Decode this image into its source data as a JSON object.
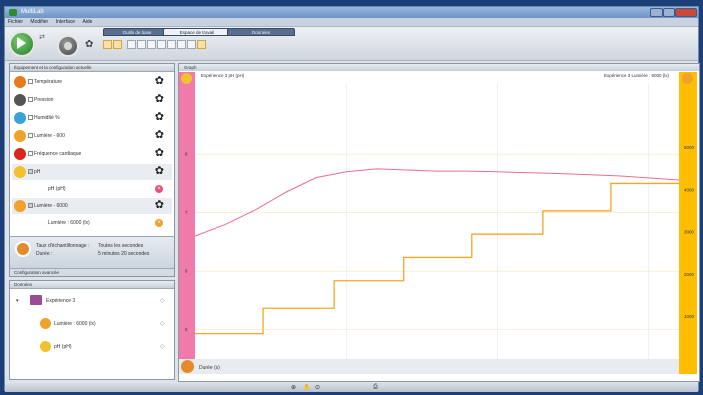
{
  "app": {
    "title": "MultiLab"
  },
  "menu": [
    "Fichier",
    "Modifier",
    "Interface",
    "Aide"
  ],
  "tabs": [
    {
      "label": "Outils de base",
      "active": false
    },
    {
      "label": "Espace de travail",
      "active": true
    },
    {
      "label": "Données",
      "active": false
    }
  ],
  "config_panel": {
    "title": "Équipement et la configuration actuelle",
    "sensors": [
      {
        "label": "Température",
        "icon": "thermometer-icon",
        "color": "#e87a1e"
      },
      {
        "label": "Pression",
        "icon": "pressure-icon",
        "color": "#555555"
      },
      {
        "label": "Humidité %",
        "icon": "humidity-icon",
        "color": "#39a3d8"
      },
      {
        "label": "Lumière - 600",
        "icon": "light-icon",
        "color": "#f0a22a"
      },
      {
        "label": "Fréquence cardiaque",
        "icon": "heart-icon",
        "color": "#d8261d"
      },
      {
        "label": "pH",
        "icon": "ph-icon",
        "color": "#f2c12e",
        "checked": true
      },
      {
        "label": "Lumière - 6000",
        "icon": "light-icon",
        "color": "#f0a22a",
        "checked": true
      }
    ],
    "sub_items": [
      {
        "label": "pH (pH)",
        "dot_color": "#e8537a"
      },
      {
        "label": "Lumière : 6000 (lx)",
        "dot_color": "#f0a22a"
      }
    ],
    "rate_label": "Taux d'échantillonnage :",
    "rate_value": "Toutes les secondes",
    "duration_label": "Durée :",
    "duration_value": "5 minutes 20 secondes",
    "footer": "Configuration avancée"
  },
  "data_panel": {
    "title": "Données",
    "experiment": "Expérience 3",
    "items": [
      {
        "label": "Lumière : 6000 (lx)"
      },
      {
        "label": "pH (pH)"
      }
    ]
  },
  "graph": {
    "panel_title": "Graph",
    "left_series_label": "Expérience 3 pH (pH)",
    "right_series_label": "Expérience 3 Lumière : 6000 (lx)",
    "x_label": "Durée (s)",
    "left_ticks": [
      "8",
      "7",
      "6",
      "5"
    ],
    "right_ticks": [
      "5000",
      "4000",
      "3000",
      "2000",
      "1000"
    ],
    "x_ticks": [
      "100",
      "200",
      "300"
    ],
    "colors": {
      "left_axis": "#f07aa8",
      "right_axis": "#ffbf00",
      "ph_line": "#e96c9a",
      "light_line": "#f5a623"
    }
  },
  "chart_data": {
    "type": "line",
    "x_range": [
      0,
      320
    ],
    "series": [
      {
        "name": "Expérience 3 pH (pH)",
        "axis": "left",
        "y_range": [
          4.5,
          9.2
        ],
        "x": [
          0,
          20,
          40,
          60,
          80,
          100,
          120,
          140,
          160,
          180,
          200,
          240,
          280,
          320
        ],
        "values": [
          6.6,
          6.8,
          7.05,
          7.35,
          7.6,
          7.7,
          7.75,
          7.73,
          7.71,
          7.71,
          7.7,
          7.67,
          7.63,
          7.56
        ]
      },
      {
        "name": "Expérience 3 Lumière : 6000 (lx)",
        "axis": "right",
        "y_range": [
          0,
          6500
        ],
        "x": [
          0,
          45,
          45,
          92,
          92,
          138,
          138,
          183,
          183,
          230,
          230,
          275,
          275,
          320
        ],
        "values": [
          600,
          600,
          1200,
          1200,
          1850,
          1850,
          2400,
          2400,
          2950,
          2950,
          3500,
          3500,
          4150,
          4150
        ]
      }
    ]
  }
}
